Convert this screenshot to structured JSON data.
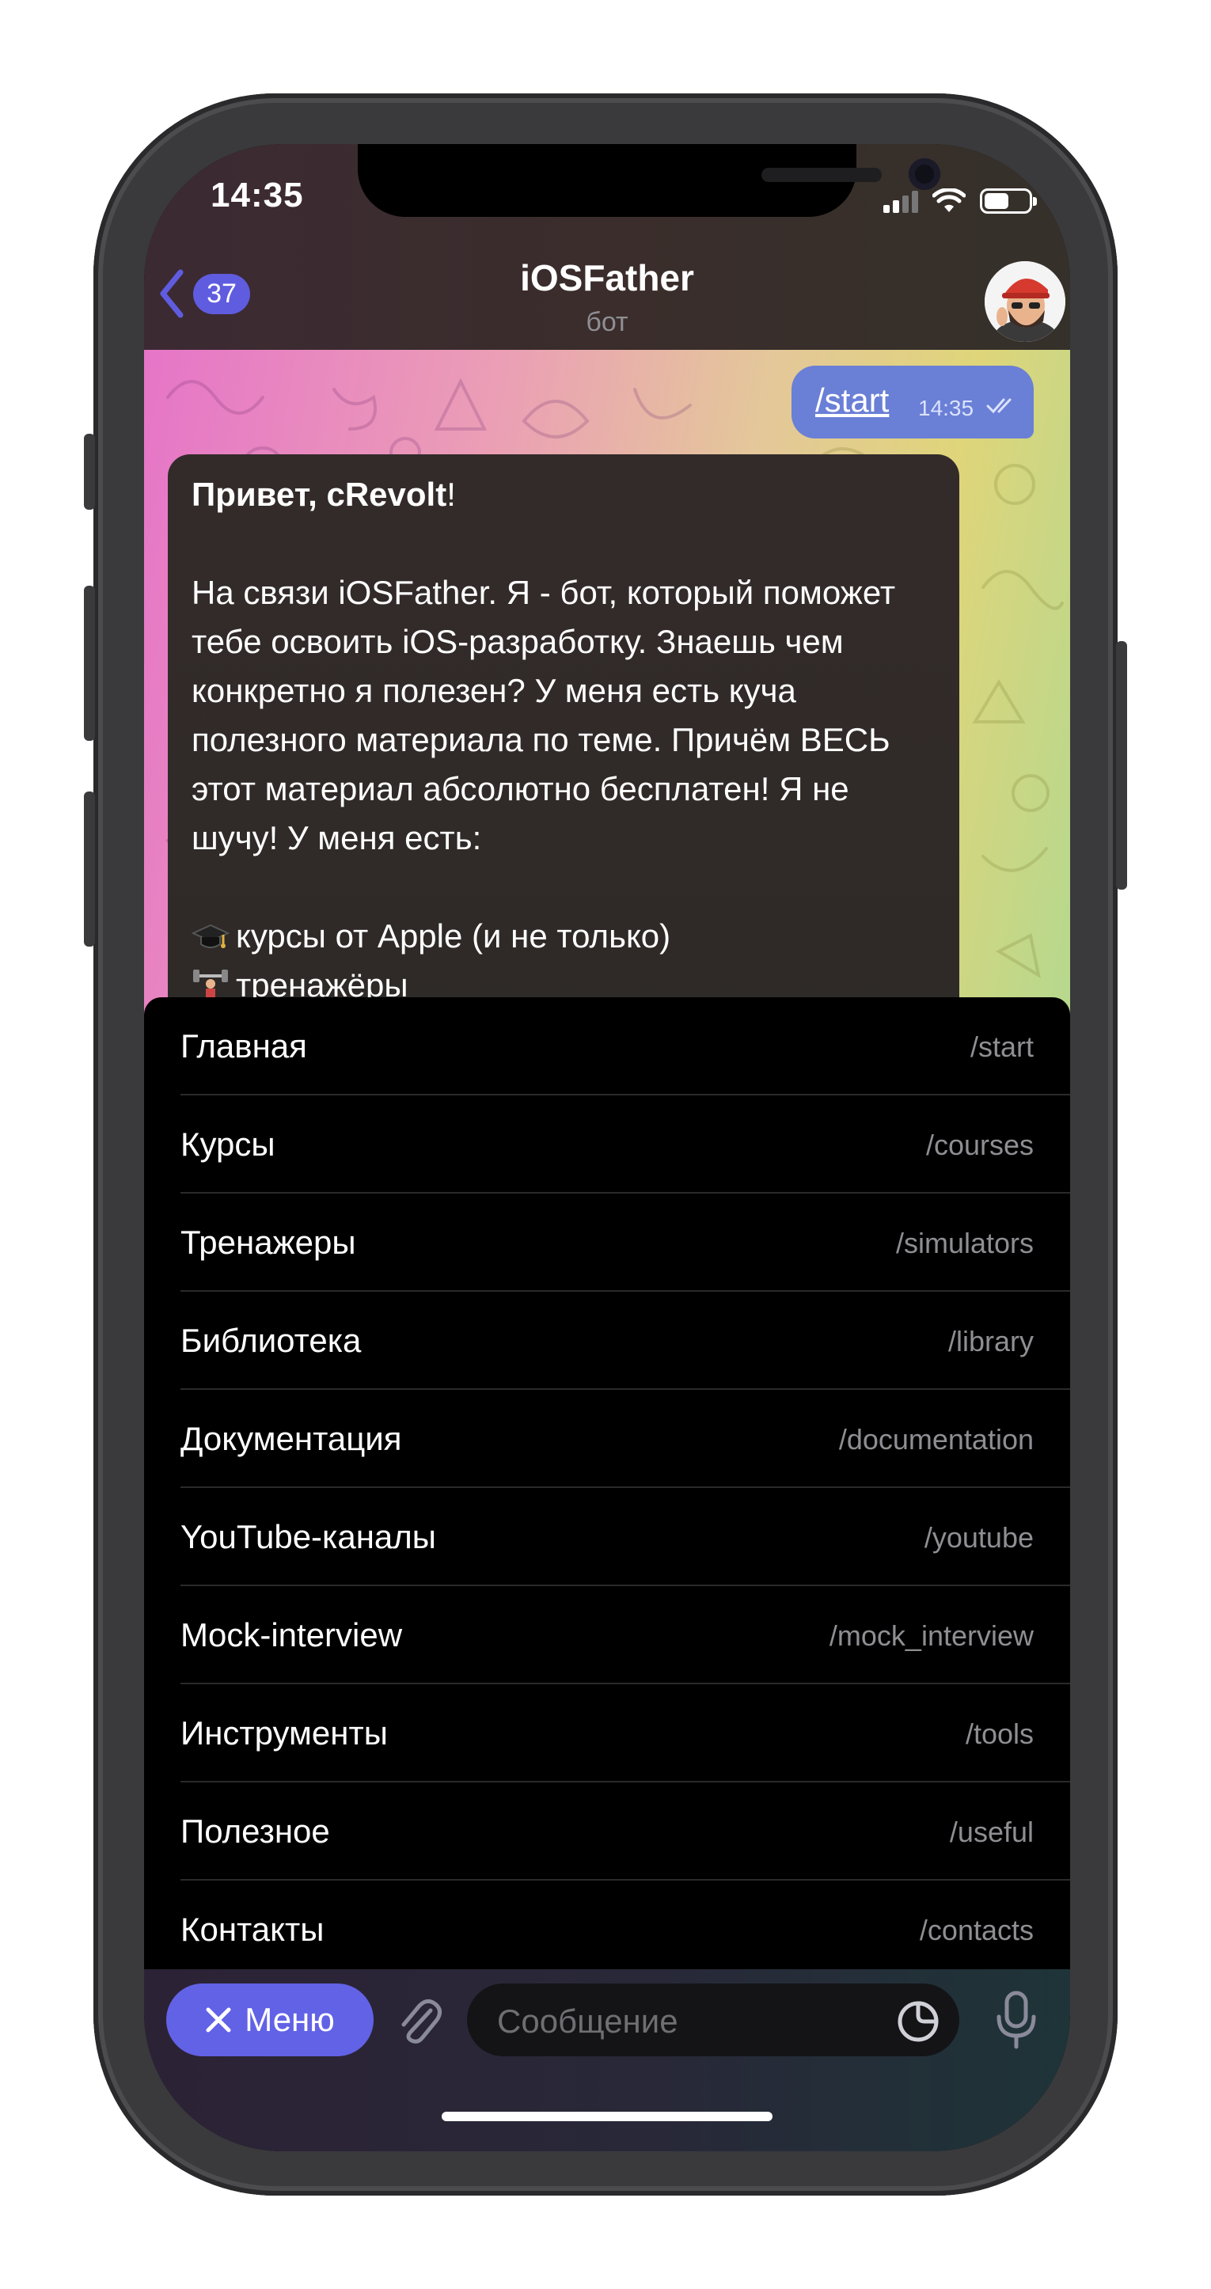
{
  "status_bar": {
    "time": "14:35"
  },
  "header": {
    "back_badge": "37",
    "title": "iOSFather",
    "subtitle": "бот"
  },
  "messages": {
    "outgoing": {
      "text": "/start",
      "time": "14:35"
    },
    "incoming": {
      "greeting": "Привет, cRevolt",
      "greeting_end": "!",
      "body": "На связи iOSFather. Я - бот, который поможет тебе освоить iOS-разработку. Знаешь чем конкретно я полезен? У меня есть куча полезного материала по теме. Причём ВЕСЬ этот материал абсолютно бесплатен! Я не шучу! У меня есть:",
      "list_item_1": "курсы от Apple (и не только)",
      "list_item_2": "тренажёры"
    }
  },
  "menu": {
    "items": [
      {
        "label": "Главная",
        "command": "/start"
      },
      {
        "label": "Курсы",
        "command": "/courses"
      },
      {
        "label": "Тренажеры",
        "command": "/simulators"
      },
      {
        "label": "Библиотека",
        "command": "/library"
      },
      {
        "label": "Документация",
        "command": "/documentation"
      },
      {
        "label": "YouTube-каналы",
        "command": "/youtube"
      },
      {
        "label": "Mock-interview",
        "command": "/mock_interview"
      },
      {
        "label": "Инструменты",
        "command": "/tools"
      },
      {
        "label": "Полезное",
        "command": "/useful"
      },
      {
        "label": "Контакты",
        "command": "/contacts"
      }
    ]
  },
  "input": {
    "menu_button": "Меню",
    "placeholder": "Сообщение"
  },
  "colors": {
    "accent": "#5f5ce0",
    "outgoing_bubble": "#6a7fd6",
    "incoming_bubble": "#2e2a27",
    "menu_bg": "#000000",
    "muted": "#8e8e93"
  },
  "icons": [
    "back-chevron-icon",
    "signal-icon",
    "wifi-icon",
    "battery-icon",
    "double-check-icon",
    "graduation-cap-icon",
    "weightlifter-icon",
    "close-icon",
    "paperclip-icon",
    "sticker-icon",
    "microphone-icon"
  ]
}
